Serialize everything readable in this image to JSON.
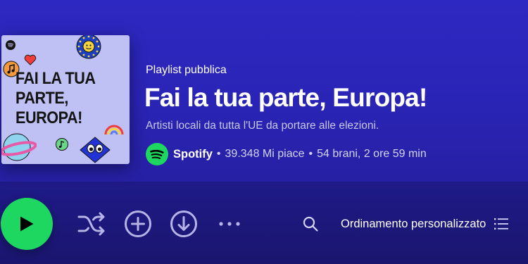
{
  "cover": {
    "title": "FAI LA TUA\nPARTE,\nEUROPA!"
  },
  "playlist": {
    "type_label": "Playlist pubblica",
    "title": "Fai la tua parte, Europa!",
    "description": "Artisti locali da tutta l'UE da portare alle elezioni.",
    "owner": "Spotify",
    "separator": "•",
    "likes": "39.348 Mi piace",
    "stats": "54 brani, 2 ore 59 min"
  },
  "actions": {
    "sort_label": "Ordinamento personalizzato"
  },
  "icons": {
    "play": "play-icon",
    "shuffle": "shuffle-icon",
    "add": "add-circle-icon",
    "download": "download-circle-icon",
    "more": "more-options-icon",
    "search": "search-icon",
    "list": "list-view-icon",
    "owner_logo": "spotify-logo-icon"
  },
  "colors": {
    "accent": "#1ed760",
    "header_bg": "#2e28c2",
    "body_bg": "#1c1872",
    "cover_bg": "#bfc0f3"
  }
}
